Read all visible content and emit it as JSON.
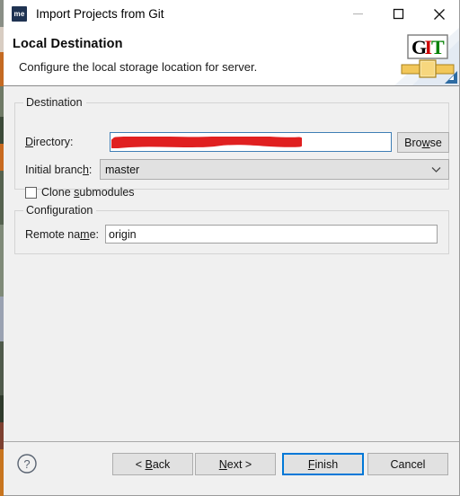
{
  "window": {
    "title": "Import Projects from Git",
    "app_icon_label": "me",
    "app_icon_color": "#1f3352",
    "controls": {
      "minimize": "minimize-icon",
      "maximize": "maximize-icon",
      "close": "close-icon"
    }
  },
  "header": {
    "title": "Local Destination",
    "description": "Configure the local storage location for server.",
    "logo": {
      "name": "git-logo",
      "letters": [
        "G",
        "I",
        "T"
      ],
      "letter_colors": [
        "#000000",
        "#cc0000",
        "#008000"
      ]
    }
  },
  "destination": {
    "group_label": "Destination",
    "directory": {
      "label": "Directory:",
      "label_mnemonic": "D",
      "value": "",
      "redacted": true,
      "redaction_color": "#e02020"
    },
    "browse_button": {
      "label": "Browse",
      "mnemonic": "w"
    },
    "initial_branch": {
      "label": "Initial branch:",
      "label_mnemonic": "h",
      "value": "master",
      "options": [
        "master"
      ]
    },
    "clone_submodules": {
      "label": "Clone submodules",
      "mnemonic": "s",
      "checked": false
    }
  },
  "configuration": {
    "group_label": "Configuration",
    "remote_name": {
      "label": "Remote name:",
      "label_mnemonic": "m",
      "value": "origin"
    }
  },
  "buttonbar": {
    "help": "help-icon",
    "back": "< Back",
    "back_mnemonic": "B",
    "next": "Next >",
    "next_mnemonic": "N",
    "finish": "Finish",
    "finish_mnemonic": "F",
    "cancel": "Cancel",
    "default_button": "Finish",
    "accent_color": "#0078d7"
  }
}
